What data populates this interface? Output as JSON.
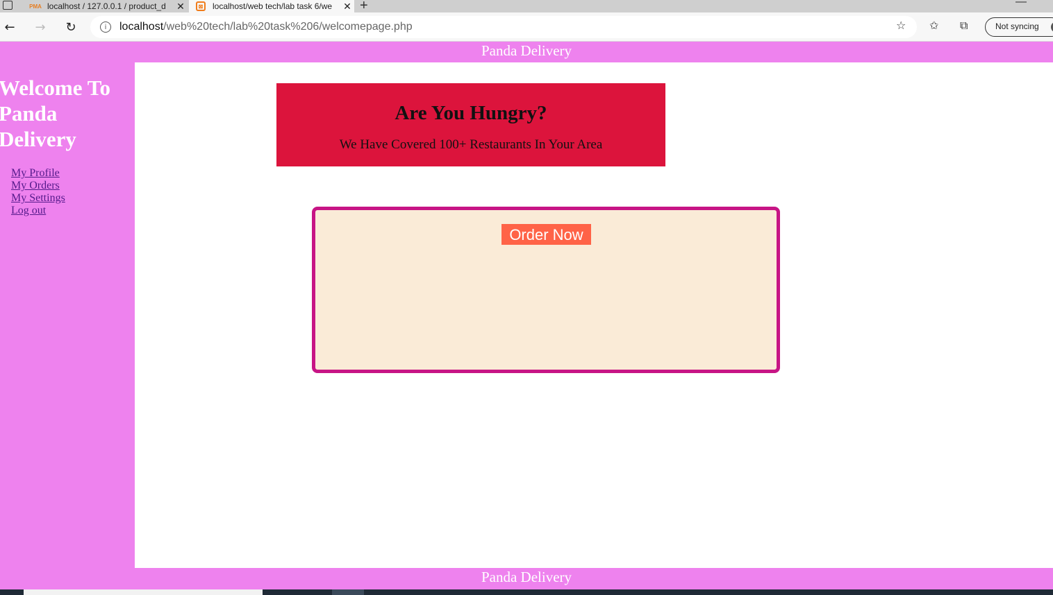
{
  "browser": {
    "tabs": [
      {
        "title": "localhost / 127.0.0.1 / product_d",
        "favicon": "PMA",
        "active": false
      },
      {
        "title": "localhost/web tech/lab task 6/we",
        "favicon": "xampp-icon",
        "active": true
      }
    ],
    "address": {
      "host": "localhost",
      "path": "/web%20tech/lab%20task%206/welcomepage.php"
    },
    "sync_label": "Not syncing"
  },
  "page": {
    "header_title": "Panda Delivery",
    "sidebar": {
      "title": "Welcome To Panda Delivery",
      "links": [
        "My Profile",
        "My Orders",
        "My Settings",
        "Log out"
      ]
    },
    "hero": {
      "heading": "Are You Hungry?",
      "subtext": "We Have Covered 100+ Restaurants In Your Area"
    },
    "order_button": "Order Now",
    "footer_title": "Panda Delivery"
  },
  "colors": {
    "header_bg": "#ee82ee",
    "hero_bg": "#dc143c",
    "order_box_bg": "#faebd7",
    "order_box_border": "#c71585",
    "order_button_bg": "#ff6347"
  }
}
